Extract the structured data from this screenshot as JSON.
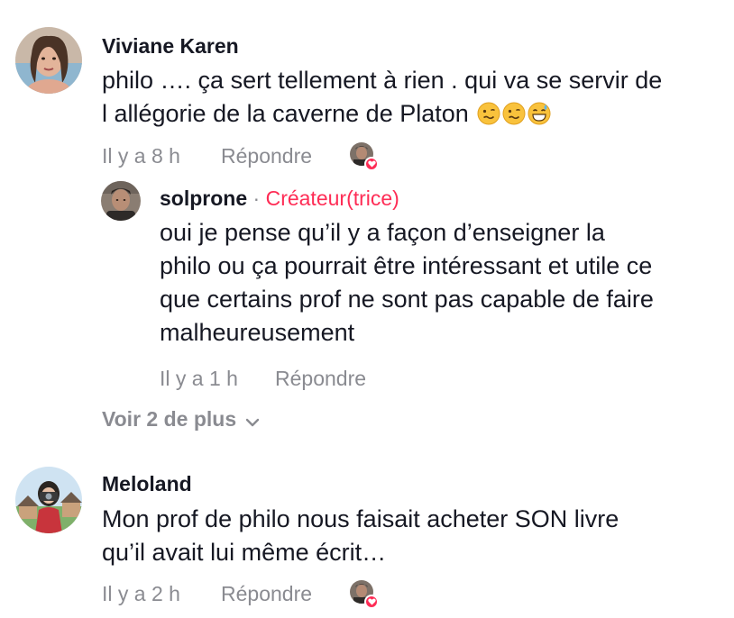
{
  "comments": [
    {
      "username": "Viviane Karen",
      "text_line1": "philo …. ça sert tellement à rien . qui va se servir de",
      "text_line2": "l allégorie de la caverne de Platon",
      "emojis": [
        "woozy-face",
        "woozy-face",
        "grinning-sweat-face"
      ],
      "time": "Il y a 8 h",
      "reply_label": "Répondre",
      "liked_by_creator": true
    },
    {
      "username": "Meloland",
      "text_line1": "Mon prof de philo nous faisait acheter SON livre",
      "text_line2": "qu’il avait lui même écrit…",
      "time": "Il y a 2 h",
      "reply_label": "Répondre",
      "liked_by_creator": true
    }
  ],
  "reply": {
    "username": "solprone",
    "separator": "·",
    "creator_label": "Créateur(trice)",
    "lines": [
      "oui je pense qu’il y a façon d’enseigner la",
      "philo ou ça pourrait être intéressant et utile ce",
      "que certains prof ne sont pas capable de faire",
      "malheureusement"
    ],
    "time": "Il y a 1 h",
    "reply_label": "Répondre"
  },
  "view_more": "Voir 2 de plus",
  "colors": {
    "text": "#161823",
    "muted": "#8a8b91",
    "creator_accent": "#fe2c55"
  }
}
